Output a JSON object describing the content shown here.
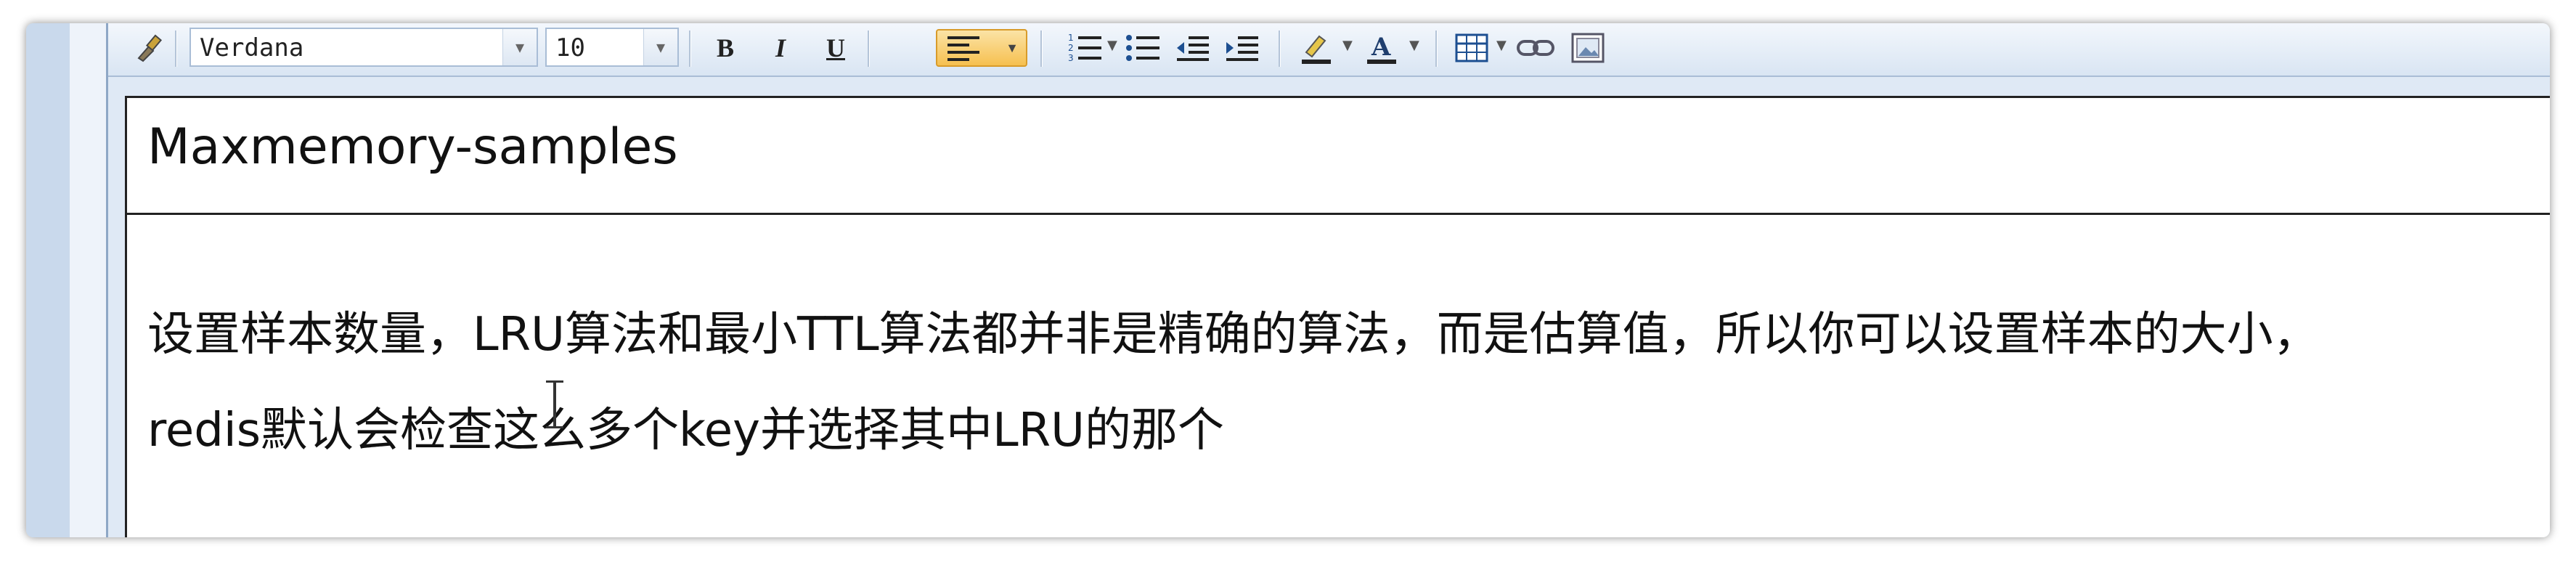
{
  "toolbar": {
    "font_family": "Verdana",
    "font_size": "10",
    "bold_label": "B",
    "italic_label": "I",
    "underline_label": "U",
    "active_color": "#f6c050",
    "highlight_color": "#f0c000",
    "text_color": "#1a1a1a"
  },
  "document": {
    "title": "Maxmemory-samples",
    "line1": "设置样本数量，LRU算法和最小TTL算法都并非是精确的算法，而是估算值，所以你可以设置样本的大小，",
    "line2": "redis默认会检查这么多个key并选择其中LRU的那个"
  }
}
